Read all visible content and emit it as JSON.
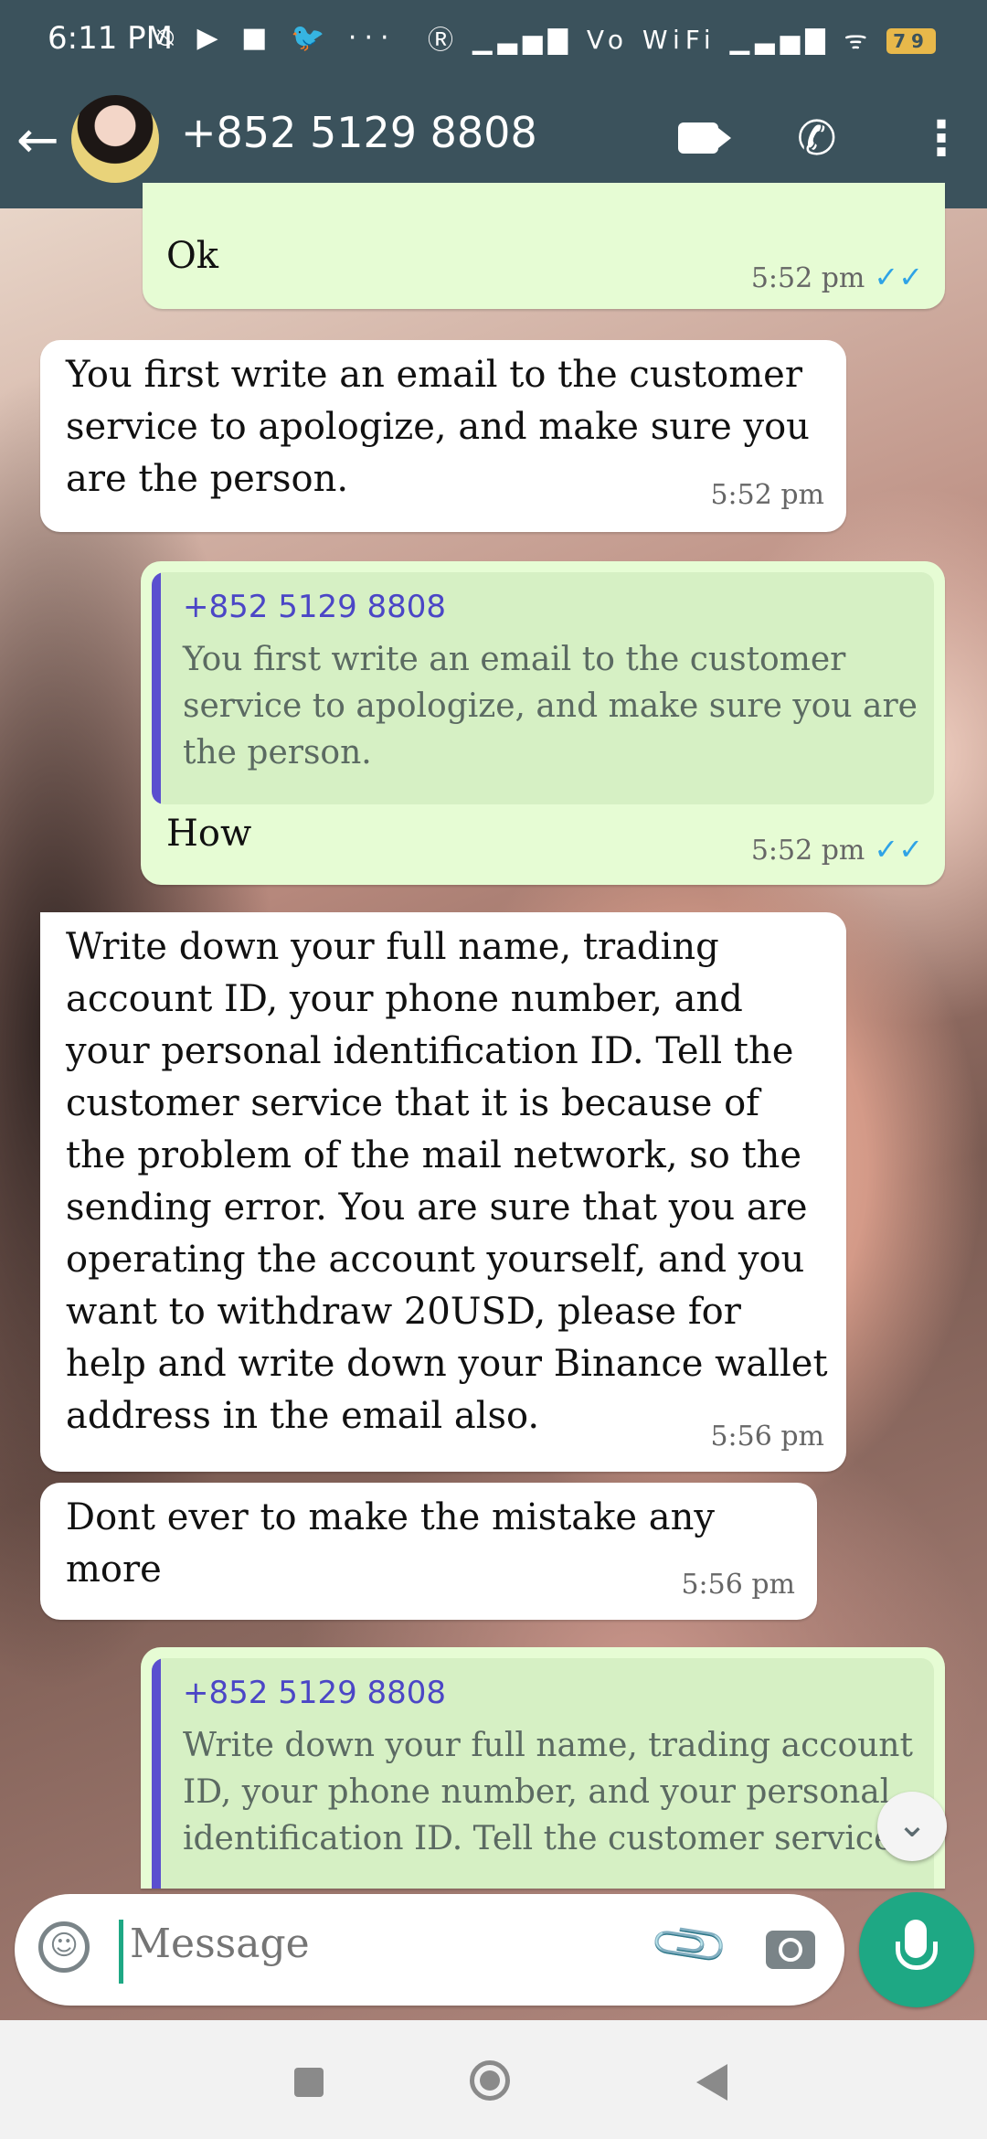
{
  "status_bar": {
    "time": "6:11 PM",
    "left_icons": "⍉ ▶ ■ 🐦 ···",
    "right_icons": "Ⓡ ▁▃▅▇ Vo WiFi ▁▃▅▇ ᯤ",
    "battery": "79"
  },
  "app_bar": {
    "contact_name": "+852 5129 8808",
    "back_icon": "←",
    "call_icon": "✆",
    "menu_icon": "⋮"
  },
  "messages": [
    {
      "direction": "out",
      "text": "Ok",
      "time": "5:52 pm",
      "ticks": "✓✓"
    },
    {
      "direction": "in",
      "lines": [
        "You first write an email to the customer",
        "service to apologize, and make sure you",
        "are the person."
      ],
      "time": "5:52 pm"
    },
    {
      "direction": "out",
      "quote": {
        "author": "+852 5129 8808",
        "lines": [
          "You first write an email to the customer",
          "service to apologize, and make sure you are",
          "the person."
        ]
      },
      "text": "How",
      "time": "5:52 pm",
      "ticks": "✓✓"
    },
    {
      "direction": "in",
      "lines": [
        "Write down your full name, trading",
        "account ID, your phone number, and",
        "your personal identification ID. Tell the",
        "customer service that it is because of",
        "the problem of the mail network, so the",
        "sending error. You are sure that you are",
        "operating the account yourself, and you",
        "want to withdraw 20USD, please for",
        "help and write down your Binance wallet",
        "address in the email also."
      ],
      "time": "5:56 pm"
    },
    {
      "direction": "in",
      "text": "Dont ever to make the mistake any more",
      "time": "5:56 pm"
    },
    {
      "direction": "out",
      "quote": {
        "author": "+852 5129 8808",
        "lines": [
          "Write down your full name, trading account",
          "ID, your phone number, and your personal",
          "identification ID. Tell the customer service th"
        ]
      }
    }
  ],
  "scroll_down_icon": "⌄",
  "input": {
    "placeholder": "Message"
  },
  "icons": {
    "emoji": "☺",
    "attach": "📎"
  }
}
